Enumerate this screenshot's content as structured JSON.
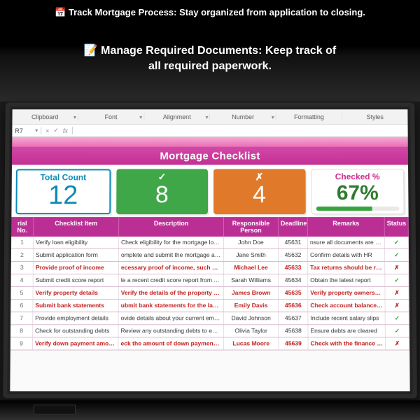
{
  "promo": {
    "line1_icon": "📅",
    "line1": "Track Mortgage Process: Stay organized from application to closing.",
    "line2_icon": "📝",
    "line2a": "Manage Required Documents: Keep track of",
    "line2b": "all required paperwork."
  },
  "ribbon": {
    "groups": [
      "Clipboard",
      "Font",
      "Alignment",
      "Number",
      "Formatting",
      "Styles"
    ]
  },
  "formula_bar": {
    "namebox": "R7",
    "buttons": [
      "×",
      "✓"
    ],
    "fx_label": "fx"
  },
  "title": "Mortgage Checklist",
  "cards": {
    "total": {
      "label": "Total Count",
      "value": "12"
    },
    "ok": {
      "label": "✓",
      "value": "8"
    },
    "bad": {
      "label": "✗",
      "value": "4"
    },
    "pct": {
      "label": "Checked %",
      "value": "67%",
      "fill_pct": 67
    }
  },
  "headers": {
    "serial": "rial No.",
    "item": "Checklist Item",
    "desc": "Description",
    "person": "Responsible Person",
    "deadline": "Deadline",
    "remarks": "Remarks",
    "status": "Status"
  },
  "rows": [
    {
      "n": "1",
      "item": "Verify loan eligibility",
      "desc": "Check eligibility for the mortgage loan.",
      "person": "John Doe",
      "deadline": "45631",
      "remarks": "nsure all documents are accurat",
      "status_ok": true
    },
    {
      "n": "2",
      "item": "Submit application form",
      "desc": "omplete and submit the mortgage application form",
      "person": "Jane Smith",
      "deadline": "45632",
      "remarks": "Confirm details with HR",
      "status_ok": true
    },
    {
      "n": "3",
      "item": "Provide proof of income",
      "desc": "ecessary proof of income, such as pay stubs or ta",
      "person": "Michael Lee",
      "deadline": "45633",
      "remarks": "Tax returns should be recent",
      "status_ok": false
    },
    {
      "n": "4",
      "item": "Submit credit score report",
      "desc": "le a recent credit score report from a recognized ag",
      "person": "Sarah Williams",
      "deadline": "45634",
      "remarks": "Obtain the latest report",
      "status_ok": true
    },
    {
      "n": "5",
      "item": "Verify property details",
      "desc": "Verify the details of the property being financed.",
      "person": "James Brown",
      "deadline": "45635",
      "remarks": "Verify property ownership",
      "status_ok": false
    },
    {
      "n": "6",
      "item": "Submit bank statements",
      "desc": "ubmit bank statements for the last three months",
      "person": "Emily Davis",
      "deadline": "45636",
      "remarks": "Check account balance history",
      "status_ok": false
    },
    {
      "n": "7",
      "item": "Provide employment details",
      "desc": "ovide details about your current employment statu",
      "person": "David Johnson",
      "deadline": "45637",
      "remarks": "Include recent salary slips",
      "status_ok": true
    },
    {
      "n": "8",
      "item": "Check for outstanding debts",
      "desc": "Review any outstanding debts to ensure eligibility.",
      "person": "Olivia Taylor",
      "deadline": "45638",
      "remarks": "Ensure debts are cleared",
      "status_ok": true
    },
    {
      "n": "9",
      "item": "Verify down payment amount",
      "desc": "eck the amount of down payment required for the",
      "person": "Lucas Moore",
      "deadline": "45639",
      "remarks": "Check with the finance team",
      "status_ok": false
    }
  ],
  "glyphs": {
    "ok": "✓",
    "no": "✗"
  }
}
